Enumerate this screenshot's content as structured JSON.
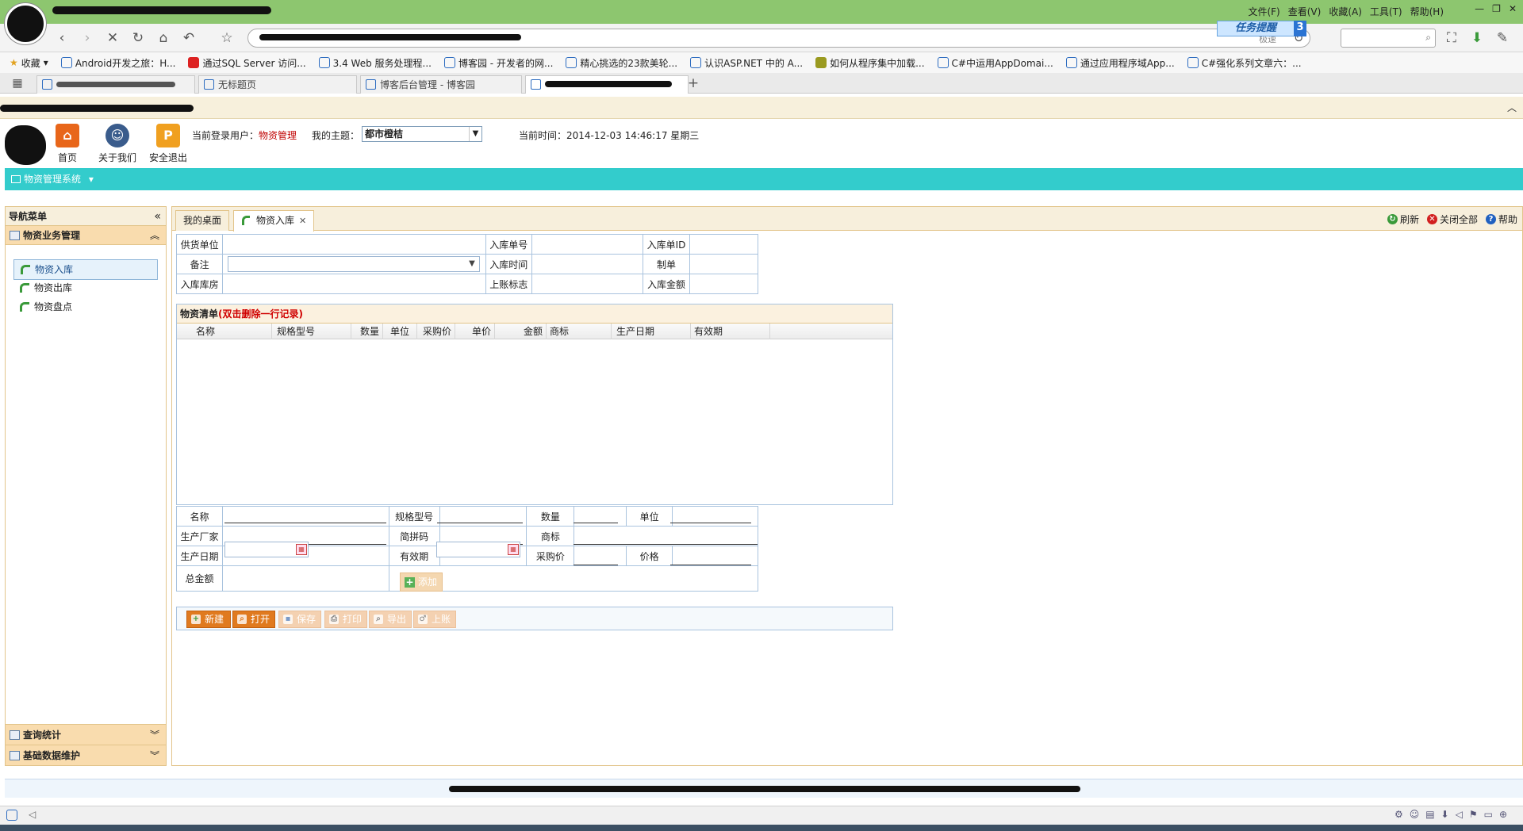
{
  "browser": {
    "menu": [
      "文件(F)",
      "查看(V)",
      "收藏(A)",
      "工具(T)",
      "帮助(H)"
    ],
    "task_badge": "任务提醒",
    "task_count": "3",
    "search_hint": "极速",
    "favorites_label": "收藏",
    "favorites": [
      "Android开发之旅：H...",
      "通过SQL Server 访问...",
      "3.4 Web 服务处理程...",
      "博客园 - 开发者的网...",
      "精心挑选的23款美轮...",
      "认识ASP.NET 中的 A...",
      "如何从程序集中加载...",
      "C#中运用AppDomai...",
      "通过应用程序域App...",
      "C#强化系列文章六：..."
    ],
    "tabs": [
      {
        "label": "无标题页"
      },
      {
        "label": "博客后台管理 - 博客园"
      }
    ]
  },
  "app": {
    "header_buttons": [
      {
        "label": "首页"
      },
      {
        "label": "关于我们"
      },
      {
        "label": "安全退出"
      }
    ],
    "current_user_label": "当前登录用户：",
    "current_user": "物资管理",
    "theme_label": "我的主题：",
    "theme_value": "都市橙桔",
    "time_label": "当前时间：",
    "time_value": "2014-12-03 14:46:17 星期三",
    "system_menu": "物资管理系统",
    "nav": {
      "title": "导航菜单",
      "section": "物资业务管理",
      "items": [
        "物资入库",
        "物资出库",
        "物资盘点"
      ],
      "bottom_sections": [
        "查询统计",
        "基础数据维护"
      ]
    },
    "tabs": [
      {
        "label": "我的桌面"
      },
      {
        "label": "物资入库"
      }
    ],
    "tools": [
      {
        "label": "刷新",
        "color": "#3a9a3a"
      },
      {
        "label": "关闭全部",
        "color": "#d22020"
      },
      {
        "label": "帮助",
        "color": "#2060c0"
      }
    ],
    "form_header": {
      "supplier": "供货单位",
      "order_no": "入库单号",
      "order_id": "入库单ID",
      "remark": "备注",
      "in_time": "入库时间",
      "maker": "制单",
      "warehouse": "入库库房",
      "post_flag": "上账标志",
      "amount": "入库金额"
    },
    "list": {
      "title": "物资清单",
      "hint": "(双击删除一行记录)",
      "columns": [
        "名称",
        "规格型号",
        "数量",
        "单位",
        "采购价",
        "单价",
        "金额",
        "商标",
        "生产日期",
        "有效期"
      ]
    },
    "detail": {
      "name": "名称",
      "spec": "规格型号",
      "qty": "数量",
      "unit": "单位",
      "maker": "生产厂家",
      "pinyin": "简拼码",
      "brand": "商标",
      "prod_date": "生产日期",
      "expiry": "有效期",
      "purchase_price": "采购价",
      "price": "价格",
      "total": "总金额",
      "add_button": "添加"
    },
    "actions": [
      {
        "label": "新建",
        "enabled": true
      },
      {
        "label": "打开",
        "enabled": true
      },
      {
        "label": "保存",
        "enabled": false
      },
      {
        "label": "打印",
        "enabled": false
      },
      {
        "label": "导出",
        "enabled": false
      },
      {
        "label": "上账",
        "enabled": false
      }
    ],
    "colors": {
      "accent_teal": "#33cccc",
      "panel_border": "#e2c48a",
      "button_orange": "#e07a1f",
      "button_disabled": "#f4d1b1"
    }
  }
}
